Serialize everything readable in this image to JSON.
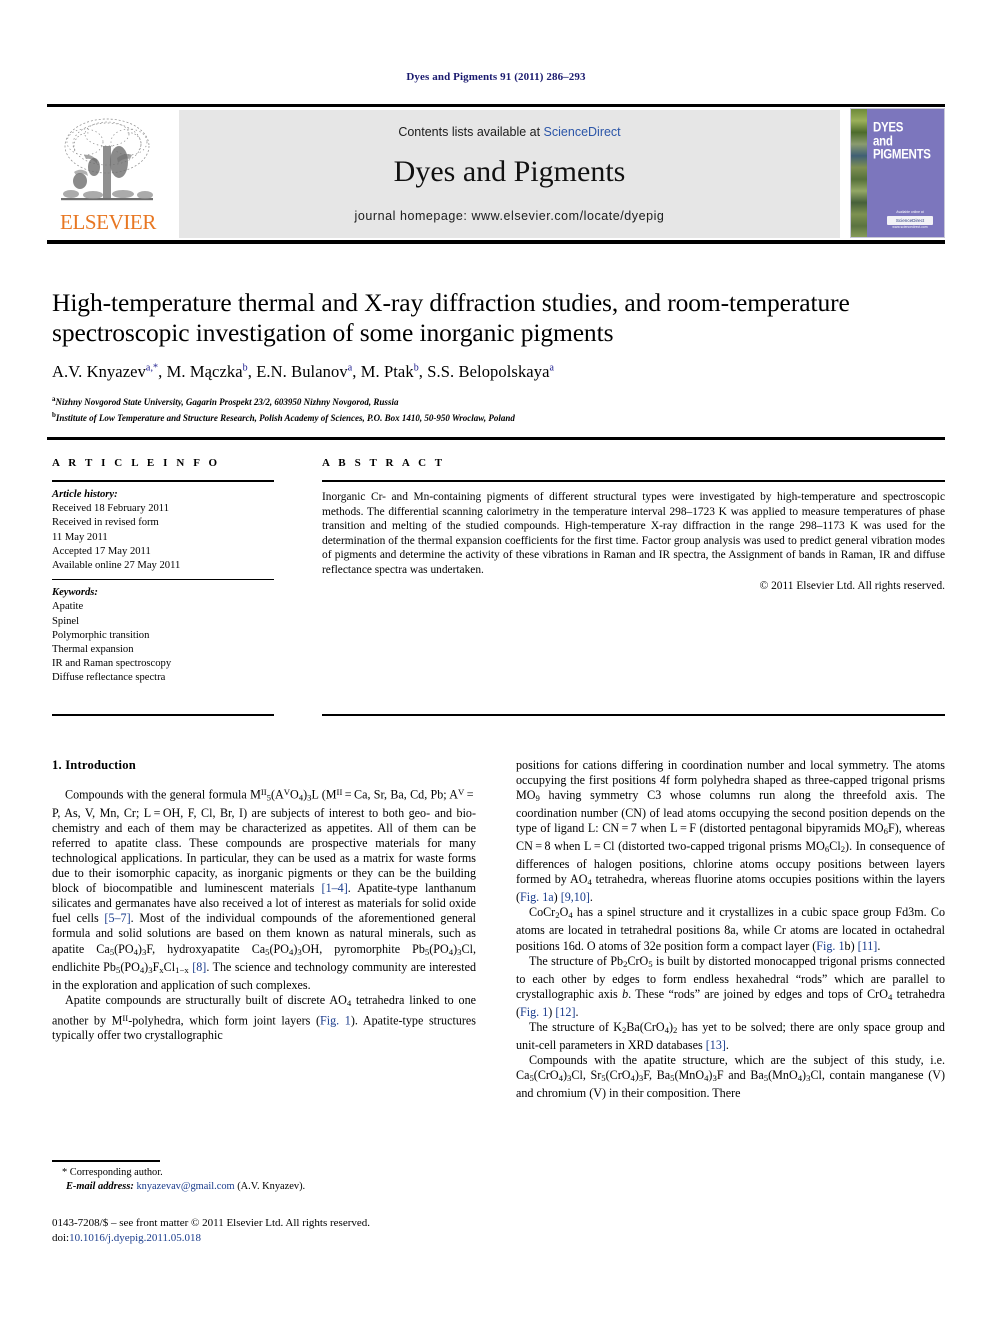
{
  "running_header": {
    "citation": "Dyes and Pigments 91 (2011) 286–293",
    "citation_color": "#1a1a6e"
  },
  "masthead": {
    "publisher_name": "ELSEVIER",
    "publisher_color": "#e87722",
    "contents_prefix": "Contents lists available at ",
    "contents_link": "ScienceDirect",
    "contents_link_color": "#2b55a8",
    "journal_title": "Dyes and Pigments",
    "homepage_label": "journal homepage: www.elsevier.com/locate/dyepig",
    "cover": {
      "line1": "DYES",
      "line2": "and",
      "line3": "PIGMENTS",
      "footer_caption": "Available online at",
      "footer_logo": "ScienceDirect",
      "footer_url": "www.sciencedirect.com",
      "background_color": "#7c76bd"
    }
  },
  "article": {
    "title": "High-temperature thermal and X-ray diffraction studies, and room-temperature spectroscopic investigation of some inorganic pigments",
    "authors": [
      {
        "name": "A.V. Knyazev",
        "marks": "a,*"
      },
      {
        "name": "M. Mączka",
        "marks": "b"
      },
      {
        "name": "E.N. Bulanov",
        "marks": "a"
      },
      {
        "name": "M. Ptak",
        "marks": "b"
      },
      {
        "name": "S.S. Belopolskaya",
        "marks": "a"
      }
    ],
    "affiliations": [
      {
        "mark": "a",
        "text": "Nizhny Novgorod State University, Gagarin Prospekt 23/2, 603950 Nizhny Novgorod, Russia"
      },
      {
        "mark": "b",
        "text": "Institute of Low Temperature and Structure Research, Polish Academy of Sciences, P.O. Box 1410, 50-950 Wroclaw, Poland"
      }
    ]
  },
  "info_section": {
    "heading_article_info": "A R T I C L E  I N F O",
    "heading_abstract": "A B S T R A C T",
    "history_label": "Article history:",
    "history_lines": [
      "Received 18 February 2011",
      "Received in revised form",
      "11 May 2011",
      "Accepted 17 May 2011",
      "Available online 27 May 2011"
    ],
    "keywords_label": "Keywords:",
    "keywords": [
      "Apatite",
      "Spinel",
      "Polymorphic transition",
      "Thermal expansion",
      "IR and Raman spectroscopy",
      "Diffuse reflectance spectra"
    ]
  },
  "abstract": {
    "text": "Inorganic Cr- and Mn-containing pigments of different structural types were investigated by high-temperature and spectroscopic methods. The differential scanning calorimetry in the temperature interval 298–1723 K was applied to measure temperatures of phase transition and melting of the studied compounds. High-temperature X-ray diffraction in the range 298–1173 K was used for the determination of the thermal expansion coefficients for the first time. Factor group analysis was used to predict general vibration modes of pigments and determine the activity of these vibrations in Raman and IR spectra, the Assignment of bands in Raman, IR and diffuse reflectance spectra was undertaken.",
    "copyright": "© 2011 Elsevier Ltd. All rights reserved."
  },
  "body": {
    "section_number_title": "1. Introduction"
  },
  "footnotes": {
    "corresponding": "* Corresponding author.",
    "email_label": "E-mail address:",
    "email": "knyazevav@gmail.com",
    "email_owner": "(A.V. Knyazev)."
  },
  "imprint": {
    "line1": "0143-7208/$ – see front matter © 2011 Elsevier Ltd. All rights reserved.",
    "doi_label": "doi:",
    "doi_value": "10.1016/j.dyepig.2011.05.018"
  }
}
